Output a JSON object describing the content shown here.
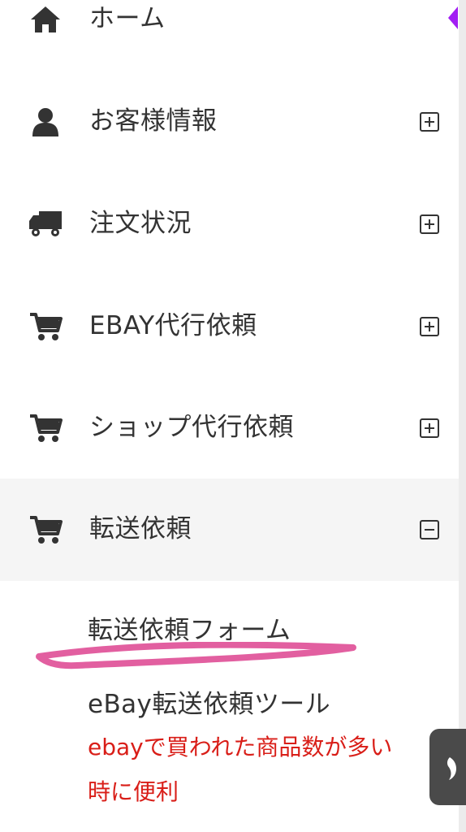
{
  "menu": {
    "items": [
      {
        "label": "ホーム",
        "icon": "home-icon"
      },
      {
        "label": "お客様情報",
        "icon": "user-icon",
        "toggle": "plus"
      },
      {
        "label": "注文状況",
        "icon": "truck-icon",
        "toggle": "plus"
      },
      {
        "label": "EBAY代行依頼",
        "icon": "cart-icon",
        "toggle": "plus"
      },
      {
        "label": "ショップ代行依頼",
        "icon": "cart-icon",
        "toggle": "plus"
      },
      {
        "label": "転送依頼",
        "icon": "cart-icon",
        "toggle": "minus"
      }
    ],
    "submenu": {
      "items": [
        {
          "label": "転送依頼フォーム"
        },
        {
          "label": "eBay転送依頼ツール"
        }
      ]
    }
  },
  "annotation": {
    "note_line1": "ebayで買われた商品数が多い",
    "note_line2": "時に便利",
    "note_color": "#d91e18",
    "highlight_color": "#e25fa0"
  },
  "colors": {
    "active_background": "#f5f5f5",
    "text": "#333333",
    "accent": "#a21ef3",
    "floating_button": "#4a4a4a"
  }
}
